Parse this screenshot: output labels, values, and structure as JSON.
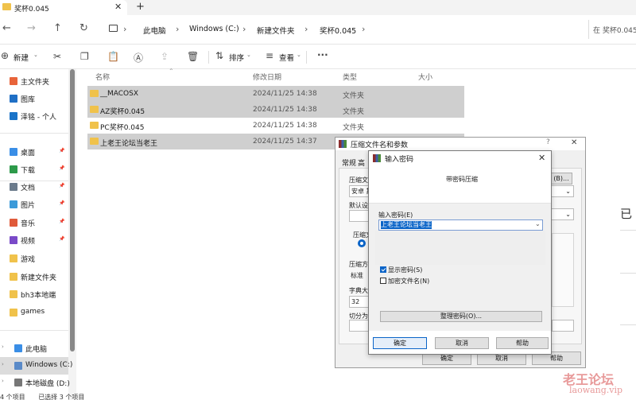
{
  "tab": {
    "title": "奖杯0.045",
    "close": "✕",
    "new": "+"
  },
  "nav": {
    "back": "←",
    "forward": "→",
    "up": "↑",
    "refresh": "↻"
  },
  "breadcrumb": [
    "此电脑",
    "Windows (C:)",
    "新建文件夹",
    "奖杯0.045"
  ],
  "search": {
    "placeholder": "在 奖杯0.045"
  },
  "toolbar": {
    "new_label": "新建",
    "sort_label": "排序",
    "view_label": "查看",
    "more": "···"
  },
  "sidebar": {
    "items": [
      {
        "label": "主文件夹",
        "icon": "home-icon",
        "color": "#e8643a"
      },
      {
        "label": "图库",
        "icon": "gallery-icon",
        "color": "#1f6fc5"
      },
      {
        "label": "泽铭 - 个人",
        "icon": "cloud-icon",
        "color": "#1a73c8"
      },
      {
        "label": "桌面",
        "icon": "desktop-icon",
        "color": "#3a8ee6",
        "pin": "📌"
      },
      {
        "label": "下载",
        "icon": "download-icon",
        "color": "#2d9a4a",
        "pin": "📌"
      },
      {
        "label": "文档",
        "icon": "documents-icon",
        "color": "#6b7b8c",
        "pin": "📌"
      },
      {
        "label": "图片",
        "icon": "pictures-icon",
        "color": "#3b9ad9",
        "pin": "📌"
      },
      {
        "label": "音乐",
        "icon": "music-icon",
        "color": "#e05a3a",
        "pin": "📌"
      },
      {
        "label": "视频",
        "icon": "video-icon",
        "color": "#7a4ac8",
        "pin": "📌"
      },
      {
        "label": "游戏",
        "icon": "folder-icon",
        "color": "#f0c24b"
      },
      {
        "label": "新建文件夹",
        "icon": "folder-icon",
        "color": "#f0c24b"
      },
      {
        "label": "bh3本地端",
        "icon": "folder-icon",
        "color": "#f0c24b"
      },
      {
        "label": "games",
        "icon": "folder-icon",
        "color": "#f0c24b"
      },
      {
        "label": "此电脑",
        "icon": "pc-icon",
        "color": "#3a8ee6"
      },
      {
        "label": "Windows (C:)",
        "icon": "drive-icon",
        "color": "#5a8ac8"
      },
      {
        "label": "本地磁盘 (D:)",
        "icon": "drive-icon",
        "color": "#777"
      }
    ]
  },
  "columns": {
    "name": "名称",
    "date": "修改日期",
    "type": "类型",
    "size": "大小"
  },
  "files": [
    {
      "name": "__MACOSX",
      "date": "2024/11/25 14:38",
      "type": "文件夹",
      "selected": true
    },
    {
      "name": "AZ奖杯0.045",
      "date": "2024/11/25 14:38",
      "type": "文件夹",
      "selected": true
    },
    {
      "name": "PC奖杯0.045",
      "date": "2024/11/25 14:38",
      "type": "文件夹",
      "selected": false
    },
    {
      "name": "上老王论坛当老王",
      "date": "2024/11/25 14:37",
      "type": "文件夹",
      "selected": true
    }
  ],
  "status": {
    "count": "4 个项目",
    "selected": "已选择 3 个项目"
  },
  "dialog_archive": {
    "title": "压缩文件名和参数",
    "help_mark": "?",
    "close": "✕",
    "tab_general": "常规",
    "tab_advanced": "高",
    "archive_name_label": "压缩文件",
    "archive_name_value": "安卓 其",
    "default_settings_label": "默认设置",
    "browse_btn": "(B)...",
    "format_label": "压缩文",
    "method_label": "压缩方式",
    "method_value": "标准",
    "dict_label": "字典大小",
    "dict_value": "32",
    "split_label": "切分为分卷",
    "ok": "确定",
    "cancel": "取消",
    "help": "帮助"
  },
  "dialog_password": {
    "title": "输入密码",
    "close": "✕",
    "heading": "带密码压缩",
    "password_label": "输入密码(E)",
    "password_value": "上老王论坛当老王",
    "show_password": "显示密码(S)",
    "show_password_checked": true,
    "encrypt_names": "加密文件名(N)",
    "encrypt_names_checked": false,
    "organize_btn": "整理密码(O)...",
    "ok": "确定",
    "cancel": "取消",
    "help": "帮助"
  },
  "right_panel": {
    "char": "已"
  },
  "watermark": {
    "cn": "老王论坛",
    "en": "laowang.vip"
  }
}
